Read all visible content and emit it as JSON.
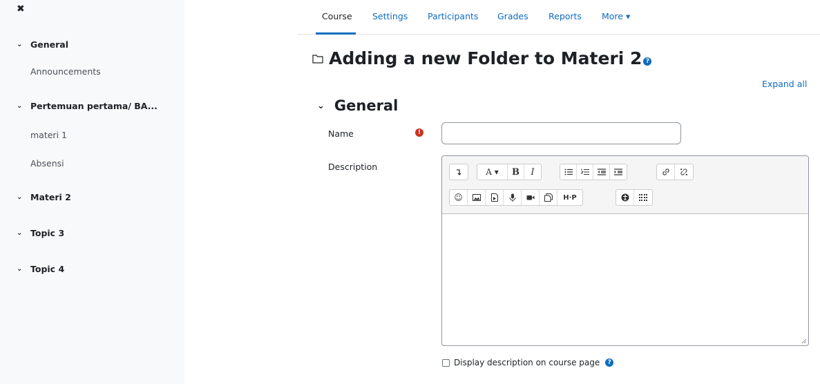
{
  "sidebar": {
    "close_icon": "✖",
    "sections": [
      {
        "label": "General",
        "items": [
          "Announcements"
        ]
      },
      {
        "label": "Pertemuan pertama/ BA...",
        "items": [
          "materi 1",
          "Absensi"
        ]
      },
      {
        "label": "Materi 2",
        "items": []
      },
      {
        "label": "Topic 3",
        "items": []
      },
      {
        "label": "Topic 4",
        "items": []
      }
    ]
  },
  "nav": {
    "tabs": [
      "Course",
      "Settings",
      "Participants",
      "Grades",
      "Reports",
      "More"
    ],
    "more_caret": "▾",
    "active_tab": "Course"
  },
  "page": {
    "title": "Adding a new Folder to Materi 2",
    "expand_all": "Expand all",
    "section_title": "General"
  },
  "form": {
    "name_label": "Name",
    "name_value": "",
    "description_label": "Description",
    "display_description_label": "Display description on course page"
  },
  "editor_toolbar": {
    "row1": [
      [
        "collapse-icon"
      ],
      [
        "font-style-icon",
        "bold-icon",
        "italic-icon"
      ],
      [
        "unordered-list-icon",
        "ordered-list-icon",
        "outdent-icon",
        "indent-icon"
      ],
      [
        "link-icon",
        "unlink-icon"
      ]
    ],
    "row2": [
      [
        "emoji-icon",
        "image-icon",
        "media-file-icon",
        "record-audio-icon",
        "record-video-icon",
        "manage-files-icon",
        "h5p-icon"
      ],
      [
        "accessibility-checker-icon",
        "screenreader-helper-icon"
      ]
    ],
    "glyphs": {
      "font_style": "A ▾",
      "bold": "B",
      "italic": "I",
      "h5p": "H·P"
    }
  },
  "colors": {
    "link": "#0f6cbf",
    "required": "#ca3120",
    "sidebar_bg": "#f8f9fa"
  }
}
